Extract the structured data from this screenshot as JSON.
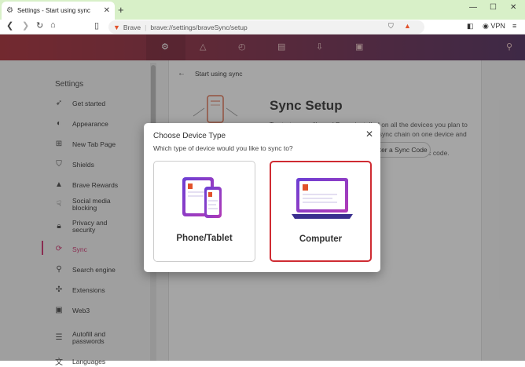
{
  "browser": {
    "tab_title": "Settings - Start using sync",
    "url_brand": "Brave",
    "url_path": "brave://settings/braveSync/setup",
    "vpn_label": "VPN"
  },
  "sidebar": {
    "title": "Settings",
    "items": [
      {
        "label": "Get started",
        "icon": "rocket-icon"
      },
      {
        "label": "Appearance",
        "icon": "palette-icon"
      },
      {
        "label": "New Tab Page",
        "icon": "new-tab-icon"
      },
      {
        "label": "Shields",
        "icon": "shield-icon"
      },
      {
        "label": "Brave Rewards",
        "icon": "rewards-icon"
      },
      {
        "label": "Social media blocking",
        "icon": "thumbs-down-icon"
      },
      {
        "label": "Privacy and security",
        "icon": "lock-icon"
      },
      {
        "label": "Sync",
        "icon": "sync-icon"
      },
      {
        "label": "Search engine",
        "icon": "search-icon"
      },
      {
        "label": "Extensions",
        "icon": "puzzle-icon"
      },
      {
        "label": "Web3",
        "icon": "wallet-icon"
      },
      {
        "label": "Autofill and passwords",
        "icon": "list-icon"
      },
      {
        "label": "Languages",
        "icon": "languages-icon"
      }
    ],
    "active_item": "Sync"
  },
  "main": {
    "breadcrumb": "Start using sync",
    "heading": "Sync Setup",
    "desc_line1": "To start, you will need Brave installed on all the devices you plan to",
    "desc_line2": "sync. To chain them together, start a sync chain on one device and then",
    "desc_line3": "link each of your other devices to the chain with a sync code.",
    "enter_code_label": "Enter a Sync Code"
  },
  "dialog": {
    "title": "Choose Device Type",
    "subtitle": "Which type of device would you like to sync to?",
    "options": [
      {
        "label": "Phone/Tablet",
        "selected": false
      },
      {
        "label": "Computer",
        "selected": true
      }
    ]
  },
  "colors": {
    "accent": "#cf2b32",
    "active_nav": "#d0306e",
    "header_start": "#a82a35",
    "header_end": "#4e2a5c"
  }
}
